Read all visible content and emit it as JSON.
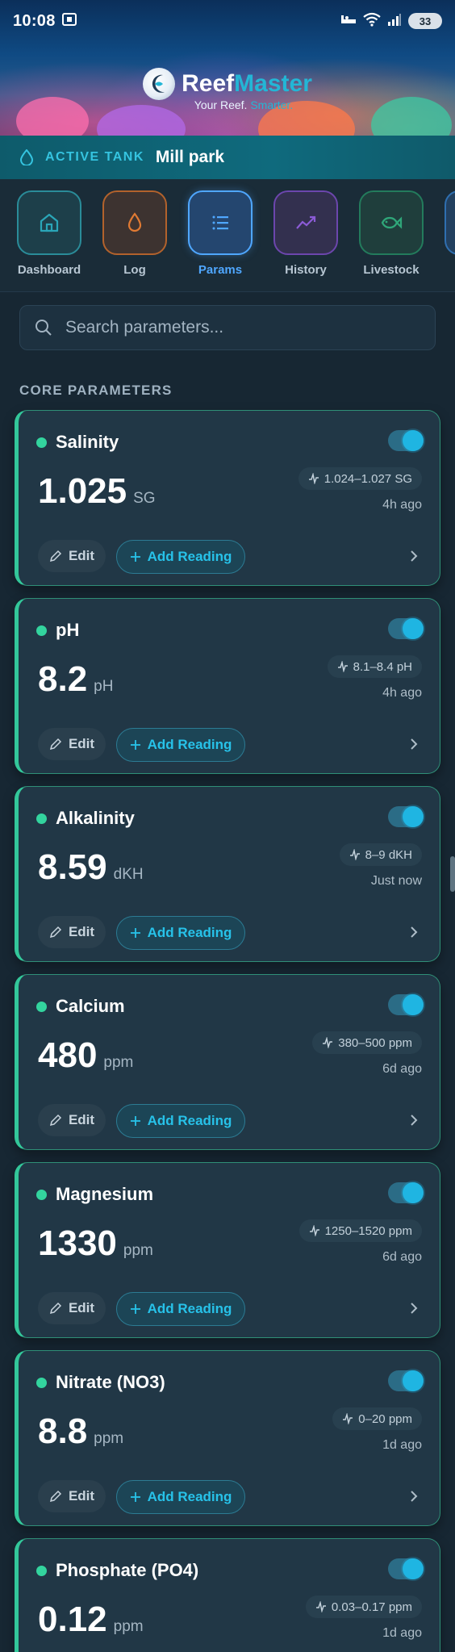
{
  "status_bar": {
    "time": "10:08",
    "battery": "33",
    "icons": [
      "screen-record-icon",
      "sleep-icon",
      "wifi-icon",
      "signal-icon",
      "battery-icon"
    ]
  },
  "app": {
    "logo_reef": "Reef",
    "logo_master": "Master",
    "tagline_prefix": "Your Reef. ",
    "tagline_accent": "Smarter."
  },
  "active_tank": {
    "label": "ACTIVE TANK",
    "name": "Mill park"
  },
  "nav": {
    "items": [
      {
        "label": "Dashboard",
        "icon": "home-icon",
        "color": "#2aa6b8",
        "active": false
      },
      {
        "label": "Log",
        "icon": "drop-icon",
        "color": "#e07a33",
        "active": false
      },
      {
        "label": "Params",
        "icon": "list-icon",
        "color": "#4fa7ff",
        "active": true
      },
      {
        "label": "History",
        "icon": "trend-icon",
        "color": "#8b5bd6",
        "active": false
      },
      {
        "label": "Livestock",
        "icon": "fish-icon",
        "color": "#2fa679",
        "active": false
      }
    ]
  },
  "search": {
    "placeholder": "Search parameters..."
  },
  "section": {
    "title": "CORE PARAMETERS"
  },
  "parameters": [
    {
      "name": "Salinity",
      "value": "1.025",
      "unit": "SG",
      "range": "1.024–1.027 SG",
      "ago": "4h ago",
      "enabled": true
    },
    {
      "name": "pH",
      "value": "8.2",
      "unit": "pH",
      "range": "8.1–8.4 pH",
      "ago": "4h ago",
      "enabled": true
    },
    {
      "name": "Alkalinity",
      "value": "8.59",
      "unit": "dKH",
      "range": "8–9 dKH",
      "ago": "Just now",
      "enabled": true
    },
    {
      "name": "Calcium",
      "value": "480",
      "unit": "ppm",
      "range": "380–500 ppm",
      "ago": "6d ago",
      "enabled": true
    },
    {
      "name": "Magnesium",
      "value": "1330",
      "unit": "ppm",
      "range": "1250–1520 ppm",
      "ago": "6d ago",
      "enabled": true
    },
    {
      "name": "Nitrate (NO3)",
      "value": "8.8",
      "unit": "ppm",
      "range": "0–20 ppm",
      "ago": "1d ago",
      "enabled": true
    },
    {
      "name": "Phosphate (PO4)",
      "value": "0.12",
      "unit": "ppm",
      "range": "0.03–0.17 ppm",
      "ago": "1d ago",
      "enabled": true
    }
  ],
  "actions": {
    "edit": "Edit",
    "add_reading": "Add Reading"
  },
  "colors": {
    "accent": "#27c2e9",
    "ok_dot": "#33d49e",
    "card_border": "#33c79a"
  }
}
